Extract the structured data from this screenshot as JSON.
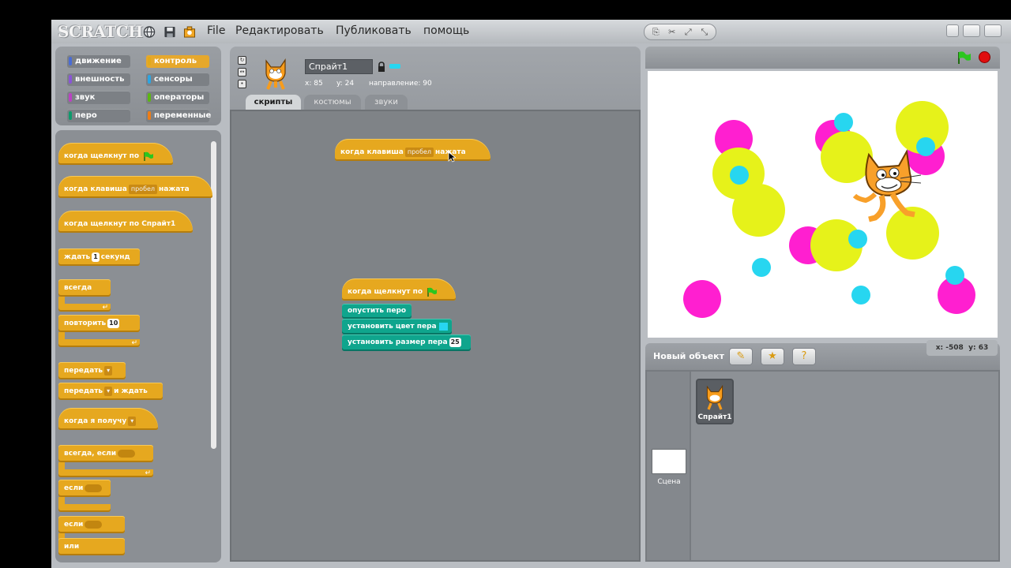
{
  "app": {
    "logo": "SCRATCH",
    "menu": [
      "File",
      "Редактировать",
      "Публиковать",
      "помощь"
    ]
  },
  "categories": [
    {
      "label": "движение",
      "color": "#4a6cd4"
    },
    {
      "label": "контроль",
      "color": "#e1a91a",
      "selected": true
    },
    {
      "label": "внешность",
      "color": "#8a55d7"
    },
    {
      "label": "сенсоры",
      "color": "#2ca5e2"
    },
    {
      "label": "звук",
      "color": "#bb42c3"
    },
    {
      "label": "операторы",
      "color": "#5cb712"
    },
    {
      "label": "перо",
      "color": "#0e9a6c"
    },
    {
      "label": "переменные",
      "color": "#ee7d16"
    }
  ],
  "palette": {
    "when_flag": "когда щелкнут по",
    "when_key": "когда клавиша",
    "when_key_value": "пробел",
    "when_key_suffix": "нажата",
    "when_clicked": "когда щелкнут по Спрайт1",
    "wait": "ждать",
    "wait_value": "1",
    "wait_suffix": "секунд",
    "forever": "всегда",
    "repeat": "повторить",
    "repeat_value": "10",
    "broadcast": "передать",
    "broadcast_wait": "передать",
    "broadcast_wait_suffix": "и ждать",
    "when_receive": "когда я получу",
    "forever_if": "всегда, если",
    "if": "если",
    "if_else": "если",
    "else": "или"
  },
  "sprite": {
    "name": "Спрайт1",
    "x_label": "x:",
    "x_value": "85",
    "y_label": "y:",
    "y_value": "24",
    "direction_label": "направление:",
    "direction_value": "90"
  },
  "tabs": [
    "скрипты",
    "костюмы",
    "звуки"
  ],
  "scripts": {
    "script1": {
      "label": "когда клавиша",
      "key": "пробел",
      "suffix": "нажата"
    },
    "script2": {
      "hat": "когда щелкнут по",
      "pen_down": "опустить перо",
      "set_color": "установить цвет пера",
      "set_size": "установить размер пера",
      "size_value": "25"
    }
  },
  "stage_panel": {
    "new_object": "Новый объект",
    "coord_x_label": "x:",
    "coord_x": "-508",
    "coord_y_label": "y:",
    "coord_y": "63",
    "stage_label": "Сцена",
    "sprite_label": "Спрайт1"
  },
  "colors": {
    "magenta": "#ff1fd0",
    "yellow": "#e6f21a",
    "cyan": "#27d6f0",
    "control": "#e6a81f",
    "pen": "#0fa58d"
  }
}
